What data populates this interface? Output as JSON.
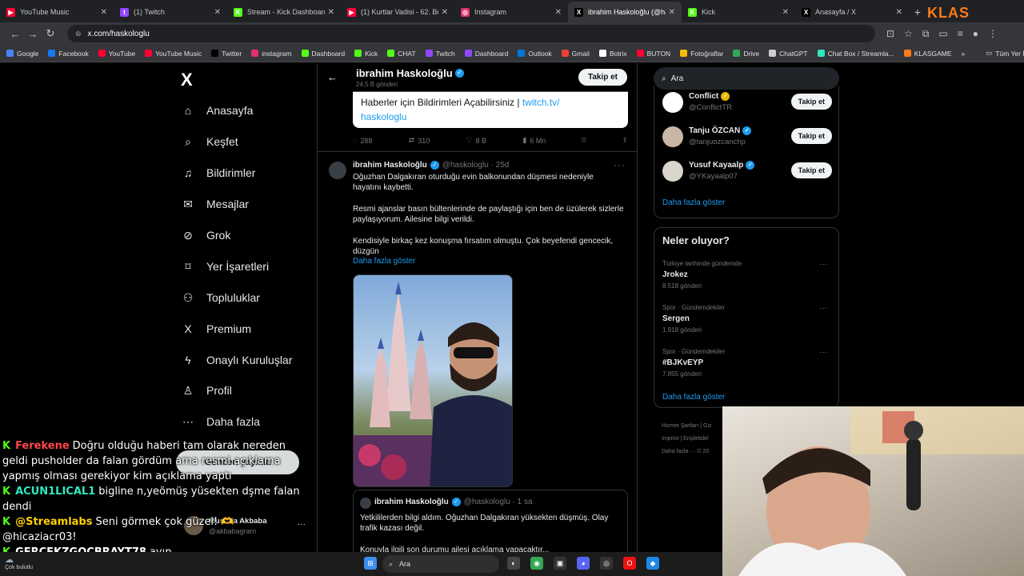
{
  "browser": {
    "tabs": [
      {
        "title": "YouTube Music",
        "color": "#ff0033",
        "glyph": "▶"
      },
      {
        "title": "(1) Twitch",
        "color": "#9146ff",
        "glyph": "t"
      },
      {
        "title": "Stream - Kick Dashboard",
        "color": "#53fc18",
        "glyph": "K"
      },
      {
        "title": "(1) Kurtlar Vadisi - 62. Böl...",
        "color": "#ff0033",
        "glyph": "▶"
      },
      {
        "title": "Instagram",
        "color": "#e1306c",
        "glyph": "◎"
      },
      {
        "title": "ibrahim Haskoloğlu (@has...",
        "color": "#000000",
        "glyph": "X",
        "active": true
      },
      {
        "title": "Kick",
        "color": "#53fc18",
        "glyph": "K"
      },
      {
        "title": "Anasayfa / X",
        "color": "#000000",
        "glyph": "X"
      }
    ],
    "new_tab": "+",
    "overlay_logo": "KLAS",
    "url": "x.com/haskologlu",
    "bookmarks": [
      {
        "label": "Google",
        "color": "#4285f4"
      },
      {
        "label": "Facebook",
        "color": "#1877f2"
      },
      {
        "label": "YouTube",
        "color": "#ff0033"
      },
      {
        "label": "YouTube Music",
        "color": "#ff0033"
      },
      {
        "label": "Twitter",
        "color": "#000000"
      },
      {
        "label": "instagram",
        "color": "#e1306c"
      },
      {
        "label": "Dashboard",
        "color": "#53fc18"
      },
      {
        "label": "Kick",
        "color": "#53fc18"
      },
      {
        "label": "CHAT",
        "color": "#53fc18"
      },
      {
        "label": "Twitch",
        "color": "#9146ff"
      },
      {
        "label": "Dashboard",
        "color": "#9146ff"
      },
      {
        "label": "Outlook",
        "color": "#0078d4"
      },
      {
        "label": "Gmail",
        "color": "#ea4335"
      },
      {
        "label": "Botrix",
        "color": "#ffffff"
      },
      {
        "label": "BUTON",
        "color": "#ff0033"
      },
      {
        "label": "Fotoğraflar",
        "color": "#fbbc04"
      },
      {
        "label": "Drive",
        "color": "#34a853"
      },
      {
        "label": "ChatGPT",
        "color": "#cccccc"
      },
      {
        "label": "Chat Box / Streamla...",
        "color": "#2ee8c0"
      },
      {
        "label": "KLASGAME",
        "color": "#ff7a1a"
      }
    ],
    "bookmarks_more": "»",
    "all_bookmarks": "Tüm Yer İşaretleri"
  },
  "nav": {
    "logo": "X",
    "items": [
      {
        "label": "Anasayfa",
        "icon": "⌂"
      },
      {
        "label": "Keşfet",
        "icon": "⌕"
      },
      {
        "label": "Bildirimler",
        "icon": "♫"
      },
      {
        "label": "Mesajlar",
        "icon": "✉"
      },
      {
        "label": "Grok",
        "icon": "⊘"
      },
      {
        "label": "Yer İşaretleri",
        "icon": "⌑"
      },
      {
        "label": "Topluluklar",
        "icon": "⚇"
      },
      {
        "label": "Premium",
        "icon": "X"
      },
      {
        "label": "Onaylı Kuruluşlar",
        "icon": "ϟ"
      },
      {
        "label": "Profil",
        "icon": "♙"
      },
      {
        "label": "Daha fazla",
        "icon": "⋯"
      }
    ],
    "post_button": "Gönderi yayınla",
    "account": {
      "name": "Mustafa Akbaba",
      "handle": "@akbabagram",
      "more": "···"
    }
  },
  "profile_header": {
    "name": "ibrahim Haskoloğlu",
    "posts": "24,5 B gönderi",
    "follow": "Takip et",
    "back": "←"
  },
  "prev_tweet": {
    "card_text": "Haberler için Bildirimleri Açabilirsiniz | ",
    "card_link_1": "twitch.tv/",
    "card_link_2": "haskologlu",
    "replies": "288",
    "retweets": "310",
    "likes": "8 B",
    "views": "6 Mn"
  },
  "tweet": {
    "name": "ibrahim Haskoloğlu",
    "handle": "@haskologlu · 25d",
    "more": "···",
    "paragraphs": [
      "Oğuzhan Dalgakıran oturduğu evin balkonundan düşmesi nedeniyle\nhayatını kaybetti.",
      "Resmi ajanslar basın bültenlerinde de paylaştığı için ben de üzülerek sizlerle\npaylaşıyorum. Ailesine bilgi verildi.",
      "Kendisiyle birkaç kez konuşma fırsatım olmuştu. Çok beyefendi gencecik,\ndüzgün"
    ],
    "show_more": "Daha fazla göster",
    "quoted": {
      "name": "ibrahim Haskoloğlu",
      "handle": "@haskologlu · 1 sa",
      "text": "Yetkililerden bilgi aldım. Oğuzhan Dalgakıran yüksekten düşmüş. Olay\ntrafik kazası değil.",
      "cut_line": "Konuyla ilgili son durumu ailesi açıklama yapacaktır..."
    }
  },
  "sidebar": {
    "search_placeholder": "Ara",
    "who_to_follow": [
      {
        "name": "Conflict",
        "handle": "@ConflictTR",
        "badge": "gold",
        "follow": "Takip et",
        "color": "#ffffff"
      },
      {
        "name": "Tanju ÖZCAN",
        "handle": "@tanjuozcanchp",
        "badge": "blue",
        "follow": "Takip et",
        "color": "#c9b7a6"
      },
      {
        "name": "Yusuf Kayaalp",
        "handle": "@YKayaalp07",
        "badge": "blue",
        "follow": "Takip et",
        "color": "#d9d4cc"
      }
    ],
    "show_more_1": "Daha fazla göster",
    "trends_title": "Neler oluyor?",
    "trends": [
      {
        "category": "Türkiye tarihinde gündemde",
        "topic": "Jrokez",
        "count": "8.518 gönderi"
      },
      {
        "category": "Spor · Gündemdekiler",
        "topic": "Sergen",
        "count": "1.918 gönderi"
      },
      {
        "category": "Spor · Gündemdekiler",
        "topic": "#BJKvEYP",
        "count": "7.855 gönderi"
      }
    ],
    "show_more_2": "Daha fazla göster",
    "footer": [
      "Hizmet Şartları  |  Giz",
      "Imprint  |  Erişilebilirl",
      "Daha fazla ···  © 20"
    ]
  },
  "chat": [
    {
      "user": "Ferekene",
      "style": "u1",
      "text": "Doğru olduğu haberi tam olarak nereden geldi pusholder da falan gördüm ama resmi açıklama yapmış olması gerekiyor kim açıklama yaptı"
    },
    {
      "user": "ACUN1LICAL1",
      "style": "u2",
      "text": "bigline n,yeömüş yüsekten dşme falan dendi"
    },
    {
      "user": "@Streamlabs",
      "style": "u3",
      "text": "Seni görmek çok güzel! 🫶 @hicaziacr03!"
    },
    {
      "user": "GERCEKZGOCBRAYT78",
      "style": "u4",
      "text": "ayıp"
    }
  ],
  "taskbar": {
    "weather": "Çok bulutlu",
    "search": "Ara"
  }
}
